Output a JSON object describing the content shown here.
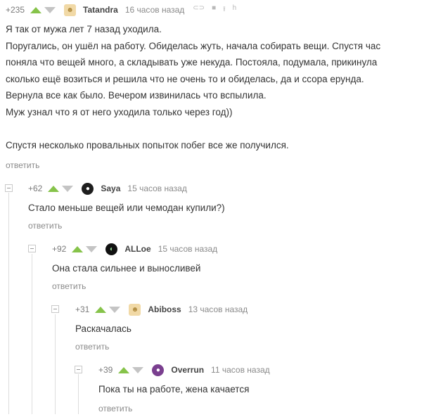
{
  "colors": {
    "vote_up": "#86c34a",
    "vote_down": "#c4c4c4",
    "thread_line": "#dddddd",
    "text": "#333333",
    "meta": "#8a8a8a"
  },
  "reply_label": "ответить",
  "comments": [
    {
      "rating": "+235",
      "author": "Tatandra",
      "time": "16 часов назад",
      "tool_icons": [
        "link-icon",
        "save-icon",
        "up-arrow-icon",
        "translate-icon"
      ],
      "lines": [
        "Я так от мужа лет 7 назад уходила.",
        "Поругались, он ушёл на работу. Обиделась жуть, начала собирать вещи. Спустя час",
        "поняла что вещей много, а складывать  уже некуда. Постояла, подумала, прикинула",
        "сколько ещё возиться и решила что не очень то и обиделась, да и ссора ерунда.",
        "Вернула все как было. Вечером извинилась что вспылила.",
        "Муж узнал что я от него уходила только через год))",
        "",
        "Спустя несколько провальных попыток побег все же получился."
      ]
    },
    {
      "rating": "+62",
      "author": "Saya",
      "time": "15 часов назад",
      "lines": [
        "Стало меньше вещей или чемодан купили?)"
      ]
    },
    {
      "rating": "+92",
      "author": "ALLoe",
      "time": "15 часов назад",
      "lines": [
        "Она стала сильнее и выносливей"
      ]
    },
    {
      "rating": "+31",
      "author": "Abiboss",
      "time": "13 часов назад",
      "lines": [
        "Раскачалась"
      ]
    },
    {
      "rating": "+39",
      "author": "Overrun",
      "time": "11 часов назад",
      "lines": [
        "Пока ты на работе, жена качается"
      ]
    }
  ]
}
